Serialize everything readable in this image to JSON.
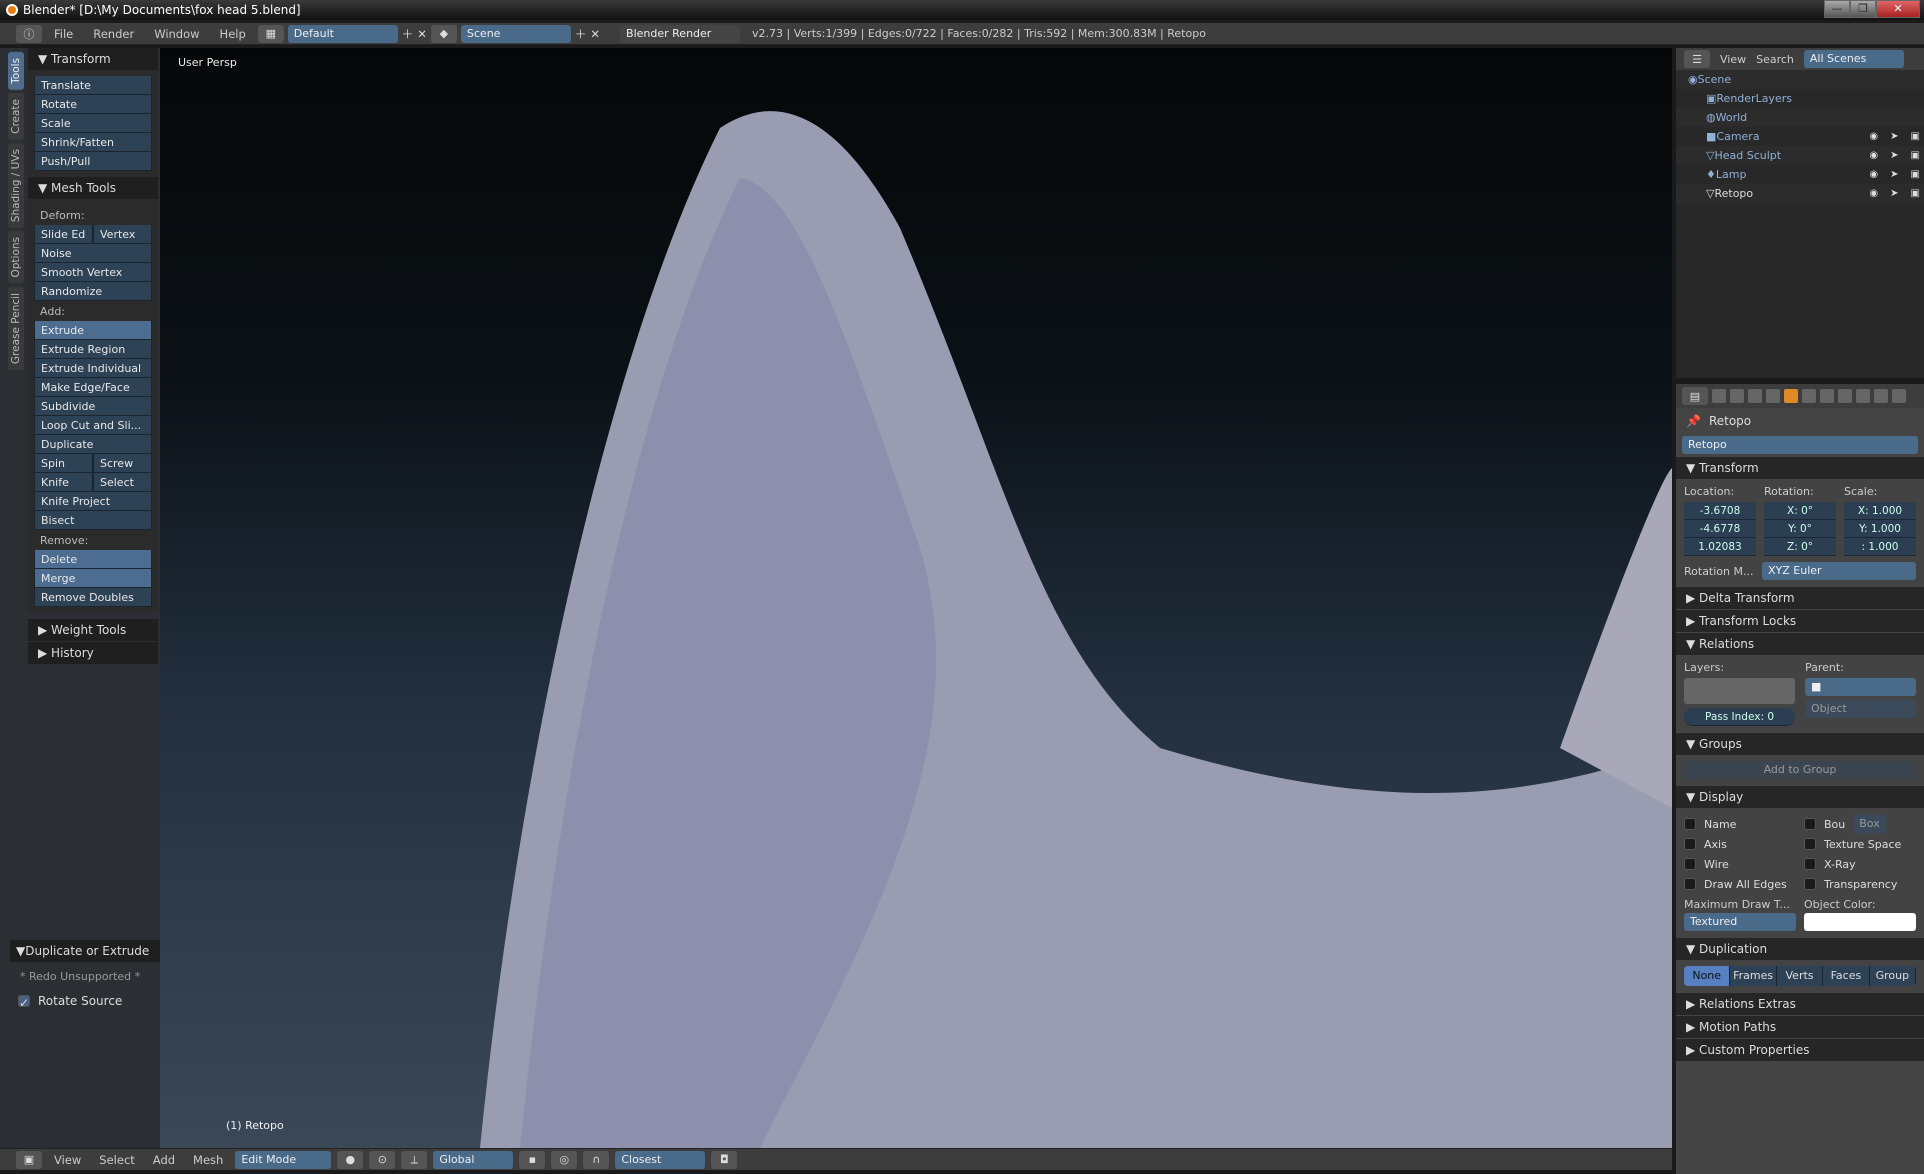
{
  "window": {
    "title": "Blender* [D:\\My Documents\\fox head 5.blend]",
    "controls": [
      "minimize",
      "restore",
      "close"
    ]
  },
  "topbar": {
    "menus": [
      "File",
      "Render",
      "Window",
      "Help"
    ],
    "layout": "Default",
    "scene": "Scene",
    "engine": "Blender Render",
    "stats": "v2.73 | Verts:1/399 | Edges:0/722 | Faces:0/282 | Tris:592 | Mem:300.83M | Retopo"
  },
  "tool_tabs": [
    "Tools",
    "Create",
    "Shading / UVs",
    "Options",
    "Grease Pencil"
  ],
  "toolshelf": {
    "transform": {
      "title": "Transform",
      "buttons": [
        "Translate",
        "Rotate",
        "Scale",
        "Shrink/Fatten",
        "Push/Pull"
      ]
    },
    "mesh_tools": {
      "title": "Mesh Tools",
      "deform_label": "Deform:",
      "slide_edge": "Slide Ed",
      "vertex": "Vertex",
      "deform": [
        "Noise",
        "Smooth Vertex",
        "Randomize"
      ],
      "add_label": "Add:",
      "extrude": "Extrude",
      "add": [
        "Extrude Region",
        "Extrude Individual",
        "Make Edge/Face",
        "Subdivide",
        "Loop Cut and Sli...",
        "Duplicate"
      ],
      "spin": "Spin",
      "screw": "Screw",
      "knife": "Knife",
      "select": "Select",
      "knife_project": "Knife Project",
      "bisect": "Bisect",
      "remove_label": "Remove:",
      "delete": "Delete",
      "merge": "Merge",
      "remove_doubles": "Remove Doubles"
    },
    "weight_tools": "Weight Tools",
    "history": "History",
    "operator": {
      "title": "Duplicate or Extrude",
      "redo": "* Redo Unsupported *",
      "rotate_source": "Rotate Source",
      "rotate_source_checked": true
    }
  },
  "viewport": {
    "view_label": "User Persp",
    "object_label": "(1) Retopo"
  },
  "bottombar": {
    "menus": [
      "View",
      "Select",
      "Add",
      "Mesh"
    ],
    "mode": "Edit Mode",
    "orientation": "Global",
    "snap": "Closest"
  },
  "outliner": {
    "menus": [
      "View",
      "Search"
    ],
    "filter": "All Scenes",
    "items": [
      {
        "name": "Scene"
      },
      {
        "name": "RenderLayers"
      },
      {
        "name": "World"
      },
      {
        "name": "Camera"
      },
      {
        "name": "Head Sculpt"
      },
      {
        "name": "Lamp"
      },
      {
        "name": "Retopo"
      }
    ]
  },
  "properties": {
    "breadcrumb": "Retopo",
    "object_name": "Retopo",
    "transform": {
      "title": "Transform",
      "location_label": "Location:",
      "rotation_label": "Rotation:",
      "scale_label": "Scale:",
      "location": [
        "-3.6708",
        "-4.6778",
        "1.02083"
      ],
      "rotation": [
        "X:  0°",
        "Y:  0°",
        "Z:  0°"
      ],
      "scale": [
        "X: 1.000",
        "Y: 1.000",
        ": 1.000"
      ],
      "rotation_mode_label": "Rotation M...",
      "rotation_mode": "XYZ Euler"
    },
    "delta_transform": "Delta Transform",
    "transform_locks": "Transform Locks",
    "relations": {
      "title": "Relations",
      "layers_label": "Layers:",
      "parent_label": "Parent:",
      "parent_type": "Object",
      "pass_index": "Pass Index:  0"
    },
    "groups": {
      "title": "Groups",
      "add": "Add to Group"
    },
    "display": {
      "title": "Display",
      "checks": [
        "Name",
        "Axis",
        "Wire",
        "Draw All Edges"
      ],
      "checks2": [
        "Bou",
        "Texture Space",
        "X-Ray",
        "Transparency"
      ],
      "bounds_type": "Box",
      "max_draw_label": "Maximum Draw T...",
      "max_draw": "Textured",
      "object_color_label": "Object Color:"
    },
    "duplication": {
      "title": "Duplication",
      "options": [
        "None",
        "Frames",
        "Verts",
        "Faces",
        "Group"
      ],
      "selected": "None"
    },
    "collapsed": [
      "Relations Extras",
      "Motion Paths",
      "Custom Properties"
    ]
  }
}
